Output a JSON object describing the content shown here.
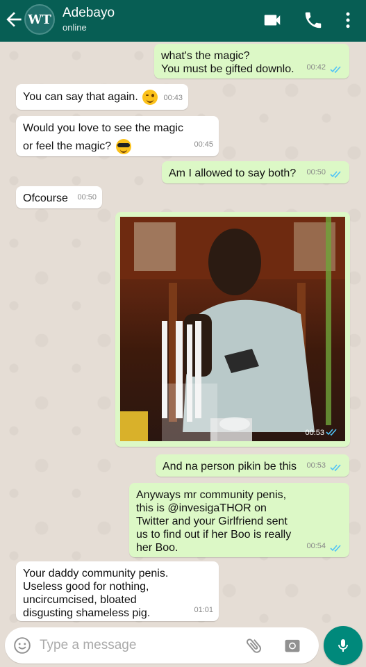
{
  "header": {
    "contact_name": "Adebayo",
    "status": "online",
    "avatar_text": "WT",
    "icons": [
      "back-arrow-icon",
      "video-call-icon",
      "phone-icon",
      "more-vert-icon"
    ]
  },
  "messages": [
    {
      "direction": "out",
      "lines": [
        "what's the magic?",
        "You must be gifted downlo."
      ],
      "time": "00:42",
      "read": true
    },
    {
      "direction": "in",
      "lines": [
        "You can say that again."
      ],
      "emoji": "winking-face",
      "time": "00:43"
    },
    {
      "direction": "in",
      "lines": [
        "Would you love to see the magic",
        "or feel the magic?"
      ],
      "emoji": "smiling-face-with-sunglasses",
      "time": "00:45"
    },
    {
      "direction": "out",
      "lines": [
        "Am I allowed to say both?"
      ],
      "time": "00:50",
      "read": true
    },
    {
      "direction": "in",
      "lines": [
        "Ofcourse"
      ],
      "time": "00:50"
    },
    {
      "direction": "out",
      "type": "image",
      "image_description": "photo of a man leaning on a chair holding drinking straws",
      "time": "00:53",
      "read": true
    },
    {
      "direction": "out",
      "lines": [
        "And na person pikin be this"
      ],
      "time": "00:53",
      "read": true
    },
    {
      "direction": "out",
      "lines": [
        "Anyways mr community penis,",
        "this is @invesigaTHOR on",
        "Twitter and your Girlfriend sent",
        "us to find out if her Boo is really",
        "her Boo."
      ],
      "time": "00:54",
      "read": true
    },
    {
      "direction": "in",
      "lines": [
        "Your daddy community penis.",
        "Useless good for nothing,",
        "uncircumcised, bloated",
        "disgusting shameless pig."
      ],
      "time": "01:01"
    }
  ],
  "composer": {
    "placeholder": "Type a message",
    "value": ""
  },
  "colors": {
    "header": "#075e54",
    "chat_bg": "#e5ddd5",
    "outgoing_bubble": "#dcf8c6",
    "incoming_bubble": "#ffffff",
    "read_ticks": "#4fc3f7",
    "mic_button": "#00897b"
  }
}
